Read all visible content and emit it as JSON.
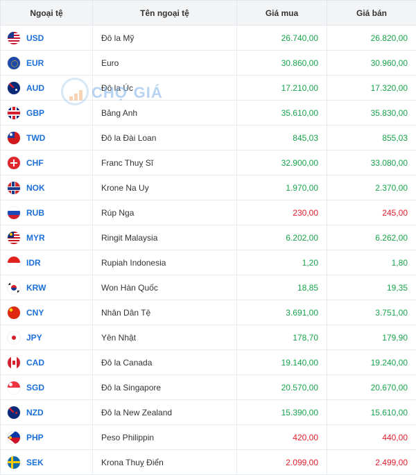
{
  "header": {
    "col_code": "Ngoại tệ",
    "col_name": "Tên ngoại tệ",
    "col_buy": "Giá mua",
    "col_sell": "Giá bán"
  },
  "watermark": {
    "text": "CHỢ GIÁ"
  },
  "rows": [
    {
      "code": "USD",
      "name": "Đô la Mỹ",
      "buy": "26.740,00",
      "sell": "26.820,00",
      "trend": "up",
      "flag": "us-flag-icon"
    },
    {
      "code": "EUR",
      "name": "Euro",
      "buy": "30.860,00",
      "sell": "30.960,00",
      "trend": "up",
      "flag": "eu-flag-icon"
    },
    {
      "code": "AUD",
      "name": "Đô la Úc",
      "buy": "17.210,00",
      "sell": "17.320,00",
      "trend": "up",
      "flag": "au-flag-icon"
    },
    {
      "code": "GBP",
      "name": "Bảng Anh",
      "buy": "35.610,00",
      "sell": "35.830,00",
      "trend": "up",
      "flag": "gb-flag-icon"
    },
    {
      "code": "TWD",
      "name": "Đô la Đài Loan",
      "buy": "845,03",
      "sell": "855,03",
      "trend": "up",
      "flag": "tw-flag-icon"
    },
    {
      "code": "CHF",
      "name": "Franc Thuỵ Sĩ",
      "buy": "32.900,00",
      "sell": "33.080,00",
      "trend": "up",
      "flag": "ch-flag-icon"
    },
    {
      "code": "NOK",
      "name": "Krone Na Uy",
      "buy": "1.970,00",
      "sell": "2.370,00",
      "trend": "up",
      "flag": "no-flag-icon"
    },
    {
      "code": "RUB",
      "name": "Rúp Nga",
      "buy": "230,00",
      "sell": "245,00",
      "trend": "down",
      "flag": "ru-flag-icon"
    },
    {
      "code": "MYR",
      "name": "Ringit Malaysia",
      "buy": "6.202,00",
      "sell": "6.262,00",
      "trend": "up",
      "flag": "my-flag-icon"
    },
    {
      "code": "IDR",
      "name": "Rupiah Indonesia",
      "buy": "1,20",
      "sell": "1,80",
      "trend": "up",
      "flag": "id-flag-icon"
    },
    {
      "code": "KRW",
      "name": "Won Hàn Quốc",
      "buy": "18,85",
      "sell": "19,35",
      "trend": "up",
      "flag": "kr-flag-icon"
    },
    {
      "code": "CNY",
      "name": "Nhân Dân Tệ",
      "buy": "3.691,00",
      "sell": "3.751,00",
      "trend": "up",
      "flag": "cn-flag-icon"
    },
    {
      "code": "JPY",
      "name": "Yên Nhật",
      "buy": "178,70",
      "sell": "179,90",
      "trend": "up",
      "flag": "jp-flag-icon"
    },
    {
      "code": "CAD",
      "name": "Đô la Canada",
      "buy": "19.140,00",
      "sell": "19.240,00",
      "trend": "up",
      "flag": "ca-flag-icon"
    },
    {
      "code": "SGD",
      "name": "Đô la Singapore",
      "buy": "20.570,00",
      "sell": "20.670,00",
      "trend": "up",
      "flag": "sg-flag-icon"
    },
    {
      "code": "NZD",
      "name": "Đô la New Zealand",
      "buy": "15.390,00",
      "sell": "15.610,00",
      "trend": "up",
      "flag": "nz-flag-icon"
    },
    {
      "code": "PHP",
      "name": "Peso Philippin",
      "buy": "420,00",
      "sell": "440,00",
      "trend": "down",
      "flag": "ph-flag-icon"
    },
    {
      "code": "SEK",
      "name": "Krona Thuỵ Điển",
      "buy": "2.099,00",
      "sell": "2.499,00",
      "trend": "down",
      "flag": "se-flag-icon"
    }
  ],
  "colors": {
    "up": "#17a34a",
    "down": "#e11d2a",
    "code": "#1b6fd8"
  }
}
